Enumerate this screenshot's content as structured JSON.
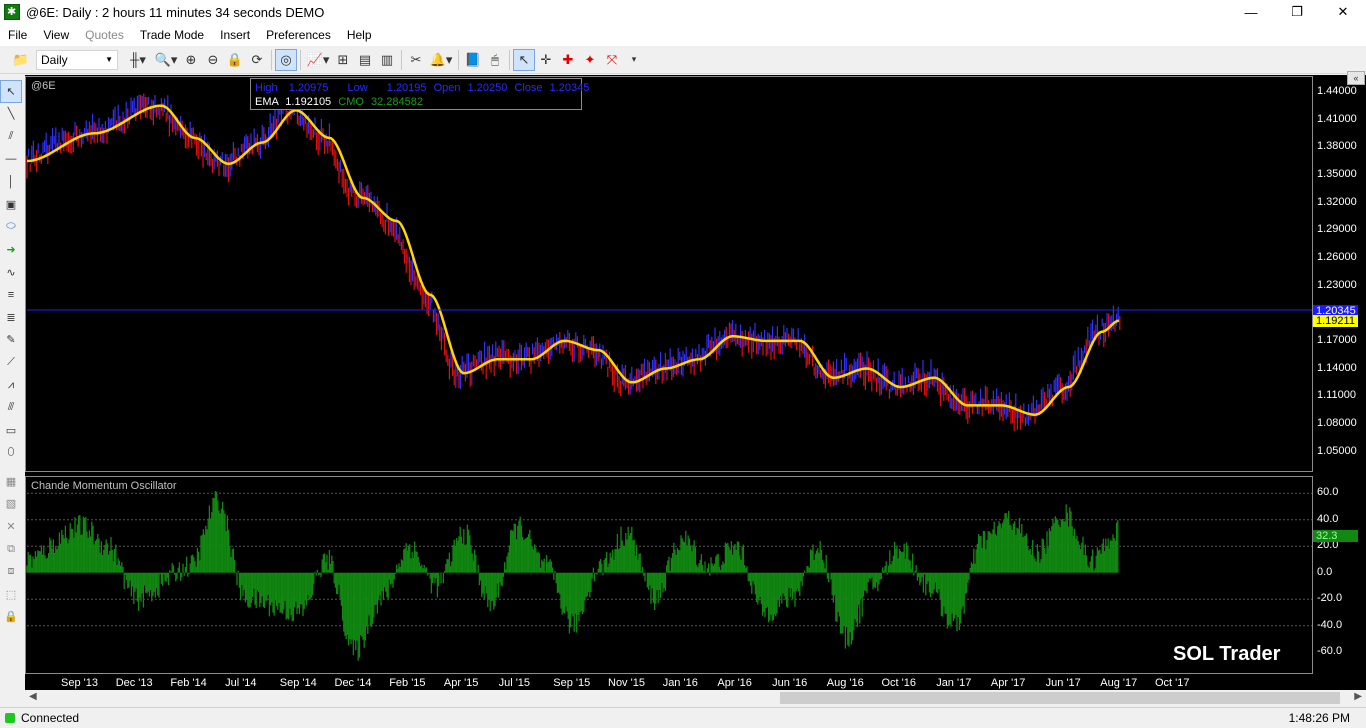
{
  "window": {
    "title": "@6E: Daily : 2 hours 11 minutes 34 seconds DEMO"
  },
  "menu": [
    "File",
    "View",
    "Quotes",
    "Trade Mode",
    "Insert",
    "Preferences",
    "Help"
  ],
  "toolbar": {
    "interval": "Daily"
  },
  "chart": {
    "symbol": "@6E",
    "data_box": {
      "high_label": "High",
      "high": "1.20975",
      "low_label": "Low",
      "low": "1.20195",
      "open_label": "Open",
      "open": "1.20250",
      "close_label": "Close",
      "close": "1.20345",
      "ema_label": "EMA",
      "ema": "1.192105",
      "cmo_label": "CMO",
      "cmo": "32.284582"
    },
    "price_tags": {
      "last": "1.20345",
      "ema": "1.19211"
    },
    "oscillator_title": "Chande Momentum Oscillator",
    "oscillator_tag": "32.3",
    "watermark": "SOL Trader"
  },
  "chart_data": {
    "type": "line",
    "price_axis": [
      "1.44000",
      "1.41000",
      "1.38000",
      "1.35000",
      "1.32000",
      "1.29000",
      "1.26000",
      "1.23000",
      "1.20000",
      "1.17000",
      "1.14000",
      "1.11000",
      "1.08000",
      "1.05000"
    ],
    "osc_axis": [
      "60.0",
      "40.0",
      "20.0",
      "0.0",
      "-20.0",
      "-40.0",
      "-60.0"
    ],
    "dates": [
      "Sep '13",
      "Dec '13",
      "Feb '14",
      "Jul '14",
      "Sep '14",
      "Dec '14",
      "Feb '15",
      "Apr '15",
      "Jul '15",
      "Sep '15",
      "Nov '15",
      "Jan '16",
      "Apr '16",
      "Jun '16",
      "Aug '16",
      "Oct '16",
      "Jan '17",
      "Apr '17",
      "Jun '17",
      "Aug '17",
      "Oct '17"
    ],
    "ylim": [
      1.03,
      1.455
    ],
    "osc_ylim": [
      -75,
      70
    ],
    "ema": [
      [
        0,
        1.365
      ],
      [
        2,
        1.395
      ],
      [
        4,
        1.425
      ],
      [
        5,
        1.39
      ],
      [
        6,
        1.362
      ],
      [
        7,
        1.385
      ],
      [
        8,
        1.42
      ],
      [
        9,
        1.39
      ],
      [
        10,
        1.325
      ],
      [
        11,
        1.3
      ],
      [
        12,
        1.22
      ],
      [
        13,
        1.135
      ],
      [
        14,
        1.15
      ],
      [
        15,
        1.15
      ],
      [
        16,
        1.17
      ],
      [
        17,
        1.16
      ],
      [
        18,
        1.125
      ],
      [
        19,
        1.14
      ],
      [
        20,
        1.15
      ],
      [
        21,
        1.175
      ],
      [
        22,
        1.17
      ],
      [
        23,
        1.17
      ],
      [
        24,
        1.13
      ],
      [
        25,
        1.14
      ],
      [
        26,
        1.12
      ],
      [
        27,
        1.13
      ],
      [
        28,
        1.1
      ],
      [
        29,
        1.1
      ],
      [
        30,
        1.09
      ],
      [
        31,
        1.12
      ],
      [
        32,
        1.18
      ],
      [
        32.5,
        1.192
      ]
    ],
    "cmo": [
      [
        0,
        10
      ],
      [
        1,
        35
      ],
      [
        1.5,
        20
      ],
      [
        2,
        -20
      ],
      [
        3,
        5
      ],
      [
        3.5,
        55
      ],
      [
        4,
        -20
      ],
      [
        5,
        -30
      ],
      [
        5.5,
        10
      ],
      [
        6,
        -60
      ],
      [
        6.5,
        -20
      ],
      [
        7,
        20
      ],
      [
        7.5,
        -10
      ],
      [
        8,
        30
      ],
      [
        8.5,
        -25
      ],
      [
        9,
        35
      ],
      [
        9.5,
        5
      ],
      [
        10,
        -40
      ],
      [
        10.5,
        5
      ],
      [
        11,
        30
      ],
      [
        11.5,
        -20
      ],
      [
        12,
        25
      ],
      [
        12.5,
        5
      ],
      [
        13,
        20
      ],
      [
        13.5,
        -30
      ],
      [
        14,
        -20
      ],
      [
        14.5,
        20
      ],
      [
        15,
        -50
      ],
      [
        15.5,
        -10
      ],
      [
        16,
        20
      ],
      [
        16.5,
        -10
      ],
      [
        17,
        -40
      ],
      [
        17.5,
        25
      ],
      [
        18,
        40
      ],
      [
        18.5,
        15
      ],
      [
        19,
        45
      ],
      [
        19.5,
        10
      ],
      [
        20,
        32
      ]
    ],
    "series": [
      {
        "name": "EMA"
      },
      {
        "name": "CMO"
      }
    ],
    "colors": {
      "ema": "#ffd700",
      "up_bar": "#3030ff",
      "down_bar": "#e01010",
      "cmo_fill": "#118811",
      "last_line": "#2020ff"
    },
    "grid": false
  },
  "status": {
    "connection": "Connected",
    "time": "1:48:26 PM"
  }
}
